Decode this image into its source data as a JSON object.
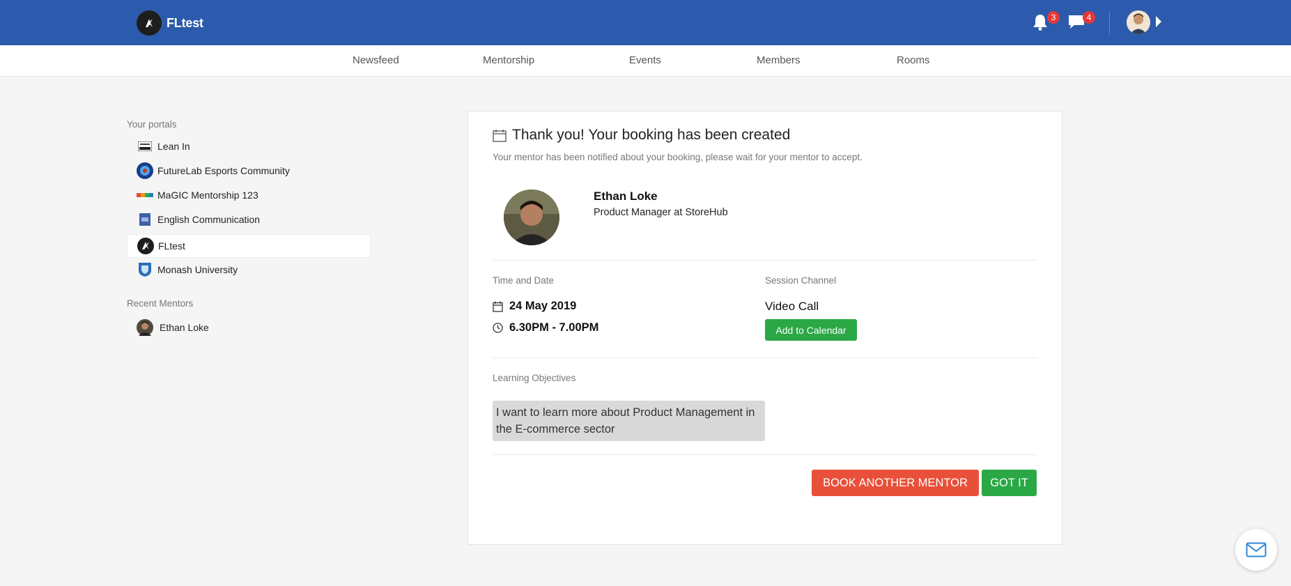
{
  "header": {
    "brand_name": "FLtest",
    "notifications_count": "3",
    "messages_count": "4",
    "colors": {
      "bar": "#2c5aac",
      "badge": "#e53935"
    }
  },
  "nav": {
    "items": [
      "Newsfeed",
      "Mentorship",
      "Events",
      "Members",
      "Rooms"
    ]
  },
  "sidebar": {
    "portals_heading": "Your portals",
    "portals": [
      {
        "label": "Lean In",
        "icon": "lean-in-logo",
        "active": false
      },
      {
        "label": "FutureLab Esports Community",
        "icon": "esports-logo",
        "active": false
      },
      {
        "label": "MaGIC Mentorship 123",
        "icon": "magic-logo",
        "active": false
      },
      {
        "label": "English Communication",
        "icon": "english-logo",
        "active": false
      },
      {
        "label": "FLtest",
        "icon": "fltest-logo",
        "active": true
      },
      {
        "label": "Monash University",
        "icon": "monash-logo",
        "active": false
      }
    ],
    "recent_heading": "Recent Mentors",
    "recent_mentors": [
      {
        "name": "Ethan Loke"
      }
    ]
  },
  "booking": {
    "title": "Thank you! Your booking has been created",
    "subtitle": "Your mentor has been notified about your booking, please wait for your mentor to accept.",
    "mentor_name": "Ethan Loke",
    "mentor_role": "Product Manager at StoreHub",
    "time_date_label": "Time and Date",
    "date": "24 May 2019",
    "time": "6.30PM - 7.00PM",
    "channel_label": "Session Channel",
    "channel": "Video Call",
    "add_to_calendar": "Add to Calendar",
    "objectives_label": "Learning Objectives",
    "objective_text": "I want to learn more about Product Management in the E-commerce sector",
    "book_another_label": "BOOK ANOTHER MENTOR",
    "got_it_label": "GOT IT",
    "colors": {
      "green": "#2aa845",
      "red": "#e8503a"
    }
  }
}
